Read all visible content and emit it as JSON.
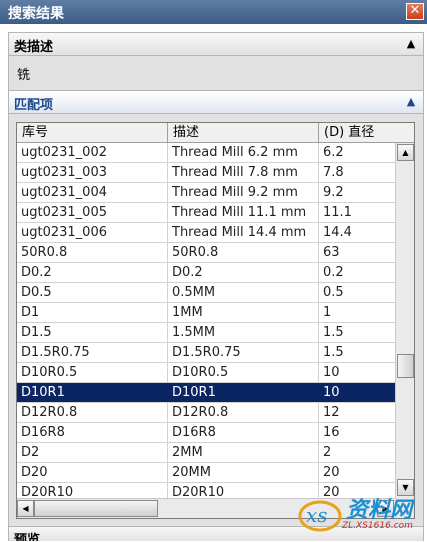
{
  "window": {
    "title": "搜索结果",
    "close_glyph": "✕"
  },
  "category": {
    "label": "类描述",
    "value": "铣",
    "collapse_glyph": "▲"
  },
  "matches": {
    "label": "匹配项",
    "collapse_glyph": "▲",
    "columns": [
      "库号",
      "描述",
      "(D) 直径"
    ],
    "rows": [
      [
        "ugt0231_002",
        "Thread Mill 6.2 mm",
        "6.2"
      ],
      [
        "ugt0231_003",
        "Thread Mill 7.8 mm",
        "7.8"
      ],
      [
        "ugt0231_004",
        "Thread Mill 9.2 mm",
        "9.2"
      ],
      [
        "ugt0231_005",
        "Thread Mill 11.1 mm",
        "11.1"
      ],
      [
        "ugt0231_006",
        "Thread Mill 14.4 mm",
        "14.4"
      ],
      [
        "50R0.8",
        "50R0.8",
        "63"
      ],
      [
        "D0.2",
        "D0.2",
        "0.2"
      ],
      [
        "D0.5",
        "0.5MM",
        "0.5"
      ],
      [
        "D1",
        "1MM",
        "1"
      ],
      [
        "D1.5",
        "1.5MM",
        "1.5"
      ],
      [
        "D1.5R0.75",
        "D1.5R0.75",
        "1.5"
      ],
      [
        "D10R0.5",
        "D10R0.5",
        "10"
      ],
      [
        "D10R1",
        "D10R1",
        "10"
      ],
      [
        "D12R0.8",
        "D12R0.8",
        "12"
      ],
      [
        "D16R8",
        "D16R8",
        "16"
      ],
      [
        "D2",
        "2MM",
        "2"
      ],
      [
        "D20",
        "20MM",
        "20"
      ],
      [
        "D20R10",
        "D20R10",
        "20"
      ]
    ],
    "selected_row": 12
  },
  "scrollbars": {
    "up": "▲",
    "down": "▼",
    "left": "◀",
    "right": "▶"
  },
  "preview": {
    "label": "预览"
  },
  "watermark": {
    "text": "资料网",
    "url": "ZL.XS1616.com"
  }
}
